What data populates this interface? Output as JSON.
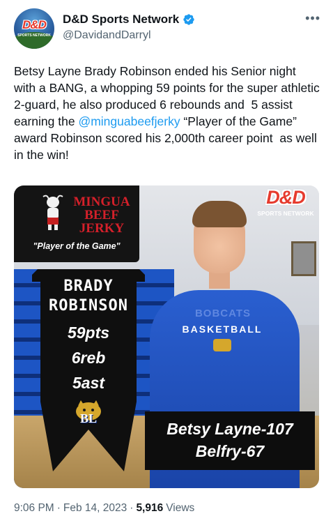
{
  "author": {
    "display_name": "D&D Sports Network",
    "handle": "@DavidandDarryl",
    "avatar_mark": "D&D",
    "avatar_sub": "SPORTS NETWORK",
    "verified": true
  },
  "tweet": {
    "text_before_mention": "Betsy Layne Brady Robinson ended his Senior night with a BANG, a whopping 59 points for the super athletic 2-guard, he also produced 6 rebounds and  5 assist earning the ",
    "mention": "@minguabeefjerky",
    "text_after_mention": " “Player of the Game” award Robinson scored his 2,000th career point  as well in the win!"
  },
  "media": {
    "sponsor_line1": "MINGUA",
    "sponsor_line2": "BEEF JERKY",
    "award": "\"Player of the Game\"",
    "logo_mark": "D&D",
    "logo_sub": "SPORTS NETWORK",
    "player_first": "BRADY",
    "player_last": "ROBINSON",
    "points": "59pts",
    "rebounds": "6reb",
    "assists": "5ast",
    "team_logo": "BL",
    "shirt_line1": "BOBCATS",
    "shirt_line2": "BASKETBALL",
    "score_line1": "Betsy Layne-107",
    "score_line2": "Belfry-67"
  },
  "meta": {
    "time": "9:06 PM",
    "sep1": "·",
    "date": "Feb 14, 2023",
    "sep2": "·",
    "views_count": "5,916",
    "views_label": "Views"
  },
  "colors": {
    "link": "#1d9bf0",
    "verified": "#1d9bf0",
    "muted": "#536471",
    "brand_red": "#e63b2e"
  },
  "icons": {
    "verified": "verified-badge-icon",
    "more": "more-options-icon"
  }
}
